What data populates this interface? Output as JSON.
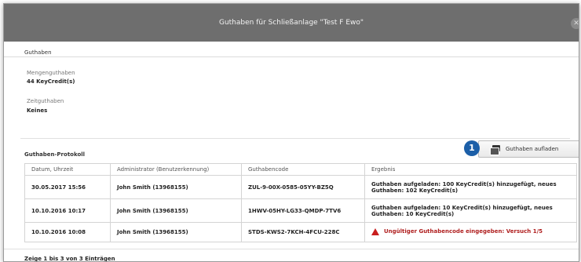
{
  "dialog": {
    "title": "Guthaben für Schließanlage \"Test F Ewo\""
  },
  "guthaben": {
    "section_label": "Guthaben",
    "mengen_label": "Mengenguthaben",
    "mengen_value": "44 KeyCredit(s)",
    "zeit_label": "Zeitguthaben",
    "zeit_value": "Keines"
  },
  "protokoll": {
    "section_label": "Guthaben-Protokoll",
    "badge": "1",
    "button_label": "Guthaben aufladen",
    "columns": [
      "Datum, Uhrzeit",
      "Administrator (Benutzerkennung)",
      "Guthabencode",
      "Ergebnis"
    ],
    "rows": [
      {
        "datum": "30.05.2017 15:56",
        "admin": "John Smith (13968155)",
        "code": "ZUL-9-00X-0585-05YY-BZ5Q",
        "ergebnis": "Guthaben aufgeladen: 100 KeyCredit(s) hinzugefügt, neues Guthaben: 102 KeyCredit(s)"
      },
      {
        "datum": "10.10.2016 10:17",
        "admin": "John Smith (13968155)",
        "code": "1HWV-05HY-LG33-QMDP-7TV6",
        "ergebnis": "Guthaben aufgeladen: 10 KeyCredit(s) hinzugefügt, neues Guthaben: 10 KeyCredit(s)"
      },
      {
        "datum": "10.10.2016 10:08",
        "admin": "John Smith (13968155)",
        "code": "STDS-KWS2-7KCH-4FCU-228C",
        "ergebnis": "Ungültiger Guthabencode eingegeben: Versuch 1/5"
      }
    ],
    "footer": "Zeige 1 bis 3 von 3 Einträgen"
  },
  "colors": {
    "titlebar": "#6e6e6e",
    "badge": "#1c5fa8",
    "warning": "#c81e1e"
  },
  "icons": {
    "close": "close-icon",
    "button": "keycard-icon",
    "warning": "warning-triangle-icon"
  }
}
